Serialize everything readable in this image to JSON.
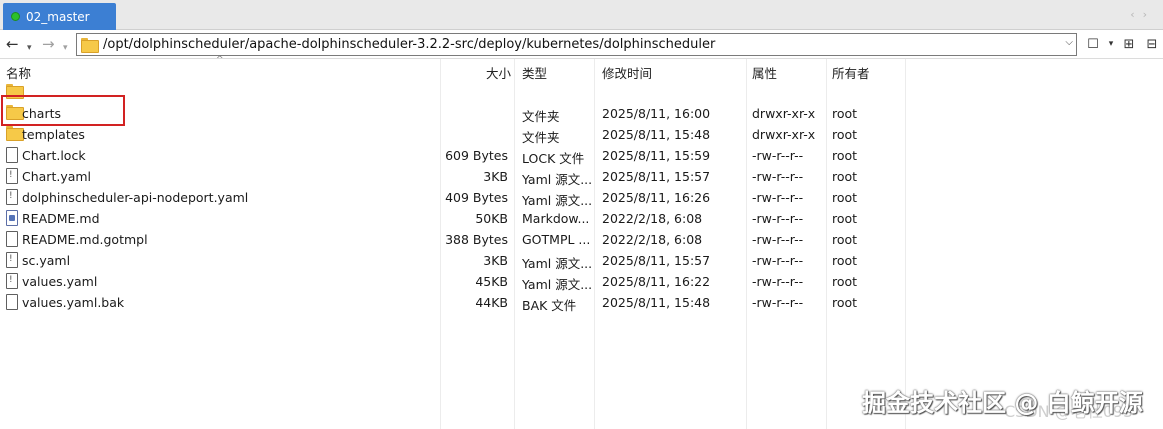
{
  "tab": {
    "title": "02_master",
    "status_color": "#2cc12c"
  },
  "tab_nav": {
    "left": "‹",
    "right": "›"
  },
  "nav": {
    "back": "←",
    "back_menu": "▾",
    "forward": "→"
  },
  "address": {
    "path": "/opt/dolphinscheduler/apache-dolphinscheduler-3.2.2-src/deploy/kubernetes/dolphinscheduler",
    "dropdown": "⌵"
  },
  "toolbar": {
    "bookmark": "☐",
    "bookmark_menu": "▾",
    "new_folder": "⊞",
    "collapse": "⊟"
  },
  "columns": {
    "name": "名称",
    "size": "大小",
    "type": "类型",
    "modified": "修改时间",
    "attributes": "属性",
    "owner": "所有者"
  },
  "files": [
    {
      "name": "..",
      "size": "",
      "type": "",
      "modified": "",
      "attributes": "",
      "owner": "",
      "icon": "folder-icon"
    },
    {
      "name": "charts",
      "size": "",
      "type": "文件夹",
      "modified": "2025/8/11, 16:00",
      "attributes": "drwxr-xr-x",
      "owner": "root",
      "icon": "folder-icon"
    },
    {
      "name": "templates",
      "size": "",
      "type": "文件夹",
      "modified": "2025/8/11, 15:48",
      "attributes": "drwxr-xr-x",
      "owner": "root",
      "icon": "folder-icon"
    },
    {
      "name": "Chart.lock",
      "size": "609 Bytes",
      "type": "LOCK 文件",
      "modified": "2025/8/11, 15:59",
      "attributes": "-rw-r--r--",
      "owner": "root",
      "icon": "file-icon"
    },
    {
      "name": "Chart.yaml",
      "size": "3KB",
      "type": "Yaml 源文...",
      "modified": "2025/8/11, 15:57",
      "attributes": "-rw-r--r--",
      "owner": "root",
      "icon": "yaml-file-icon"
    },
    {
      "name": "dolphinscheduler-api-nodeport.yaml",
      "size": "409 Bytes",
      "type": "Yaml 源文...",
      "modified": "2025/8/11, 16:26",
      "attributes": "-rw-r--r--",
      "owner": "root",
      "icon": "yaml-file-icon"
    },
    {
      "name": "README.md",
      "size": "50KB",
      "type": "Markdow...",
      "modified": "2022/2/18, 6:08",
      "attributes": "-rw-r--r--",
      "owner": "root",
      "icon": "markdown-file-icon"
    },
    {
      "name": "README.md.gotmpl",
      "size": "388 Bytes",
      "type": "GOTMPL ...",
      "modified": "2022/2/18, 6:08",
      "attributes": "-rw-r--r--",
      "owner": "root",
      "icon": "file-icon"
    },
    {
      "name": "sc.yaml",
      "size": "3KB",
      "type": "Yaml 源文...",
      "modified": "2025/8/11, 15:57",
      "attributes": "-rw-r--r--",
      "owner": "root",
      "icon": "yaml-file-icon"
    },
    {
      "name": "values.yaml",
      "size": "45KB",
      "type": "Yaml 源文...",
      "modified": "2025/8/11, 16:22",
      "attributes": "-rw-r--r--",
      "owner": "root",
      "icon": "yaml-file-icon"
    },
    {
      "name": "values.yaml.bak",
      "size": "44KB",
      "type": "BAK 文件",
      "modified": "2025/8/11, 15:48",
      "attributes": "-rw-r--r--",
      "owner": "root",
      "icon": "file-icon"
    }
  ],
  "highlight_color": "#d22222",
  "watermark": {
    "text": "掘金技术社区 @ 白鲸开源",
    "underlay": "CSDN @老杜095"
  }
}
